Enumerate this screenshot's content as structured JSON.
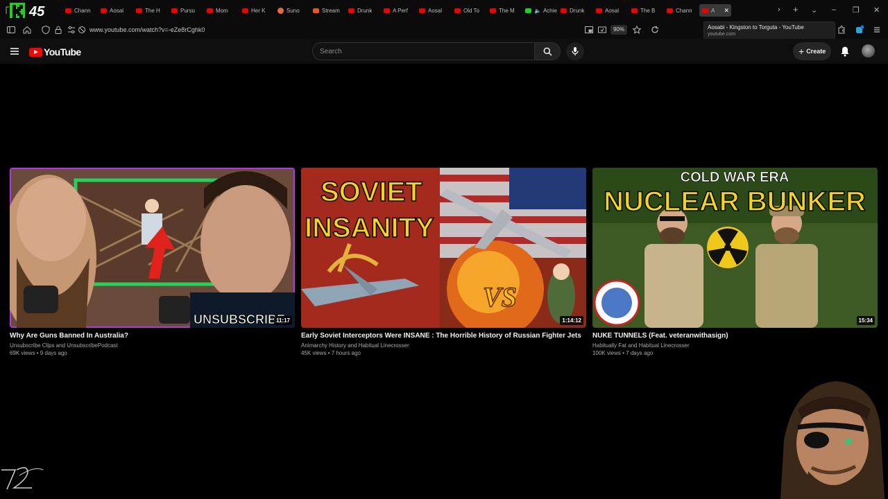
{
  "browser": {
    "tabs": [
      {
        "title": "Chann",
        "icon": "youtube-icon",
        "favicon": "yt"
      },
      {
        "title": "Aosal",
        "icon": "youtube-icon",
        "favicon": "yt"
      },
      {
        "title": "The H",
        "icon": "youtube-icon",
        "favicon": "yt"
      },
      {
        "title": "Pursu",
        "icon": "youtube-icon",
        "favicon": "yt"
      },
      {
        "title": "Mom",
        "icon": "youtube-icon",
        "favicon": "yt"
      },
      {
        "title": "Her K",
        "icon": "youtube-icon",
        "favicon": "yt"
      },
      {
        "title": "Suno",
        "icon": "sun-icon",
        "favicon": "sun"
      },
      {
        "title": "Stream",
        "icon": "stream-icon",
        "favicon": "orange"
      },
      {
        "title": "Drunk",
        "icon": "youtube-icon",
        "favicon": "yt"
      },
      {
        "title": "A Perf",
        "icon": "youtube-icon",
        "favicon": "yt"
      },
      {
        "title": "Aosal",
        "icon": "youtube-icon",
        "favicon": "yt"
      },
      {
        "title": "Old To",
        "icon": "youtube-icon",
        "favicon": "yt"
      },
      {
        "title": "The M",
        "icon": "youtube-icon",
        "favicon": "yt"
      },
      {
        "title": "Achie",
        "icon": "kick-icon",
        "favicon": "green",
        "muted": true
      },
      {
        "title": "Drunk",
        "icon": "youtube-icon",
        "favicon": "yt"
      },
      {
        "title": "Aosal",
        "icon": "youtube-icon",
        "favicon": "yt"
      },
      {
        "title": "The B",
        "icon": "youtube-icon",
        "favicon": "yt"
      },
      {
        "title": "Chann",
        "icon": "youtube-icon",
        "favicon": "yt"
      }
    ],
    "active_tab": {
      "title": "A",
      "icon": "youtube-icon"
    },
    "kick_count": "45",
    "url": "www.youtube.com/watch?v=-eZe8rCghk0",
    "zoom": "90%",
    "tooltip": {
      "title": "Aosabi - Kingston to Torguta - YouTube",
      "domain": "youtube.com"
    }
  },
  "youtube": {
    "logo_text": "YouTube",
    "search_placeholder": "Search",
    "create_label": "Create"
  },
  "videos": [
    {
      "title": "Why Are Guns Banned In Australia?",
      "channel": "Unsubscribe Clips and UnsubscribePodcast",
      "meta": "69K views • 9 days ago",
      "duration": "11:17",
      "thumb_text": "UNSUBSCRIBE"
    },
    {
      "title": "Early Soviet Interceptors Were INSANE : The Horrible History of Russian Fighter Jets",
      "channel": "Animarchy History and Habitual Linecrosser",
      "meta": "45K views • 7 hours ago",
      "duration": "1:14:12",
      "thumb_text_1": "SOVIET",
      "thumb_text_2": "INSANITY",
      "thumb_text_3": "VS"
    },
    {
      "title": "NUKE TUNNELS (Feat. veteranwithasign)",
      "channel": "Habitually Fat and Habitual Linecrosser",
      "meta": "100K views • 7 days ago",
      "duration": "15:34",
      "thumb_text_1": "COLD WAR ERA",
      "thumb_text_2": "NUCLEAR BUNKER"
    }
  ],
  "colors": {
    "yt_red": "#ff0000",
    "bg": "#000000",
    "masthead": "#0f0f0f",
    "kick_green": "#53fc18"
  }
}
